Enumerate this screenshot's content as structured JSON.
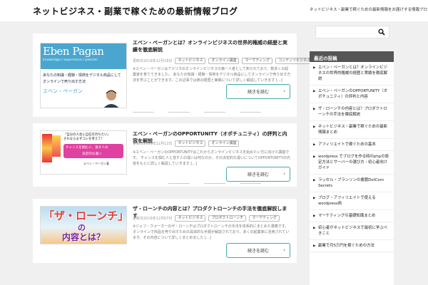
{
  "header": {
    "site_title": "ネットビジネス・副業で稼ぐための最新情報ブログ",
    "site_description": "ネットビジネス・副業で稼ぐための最新情報をお届けする情報ブログです"
  },
  "search": {
    "placeholder": ""
  },
  "posts": [
    {
      "title": "エベン・ペーガンとは？オンラインビジネスの世界的権威の経歴と実績を徹底解説",
      "date": "更新日2019年12月18日",
      "tags": [
        "ネットビジネス",
        "オンライン講座",
        "マーケティング",
        "コンテンツビジネス"
      ],
      "excerpt": "※エベン・ペーガンはアメリカのオンラインビジネスの第一人者として知られており、数多くの起業家を育ててきました。 あなたの知識・経験・情熱をデジタル商品にしてオンラインで売り出す方法を学ぶことができます。この記事では彼の経歴と実績について詳しく解説していきます […]",
      "more_label": "続きを読む",
      "thumb": {
        "name": "Eben Pagan",
        "sub": "knowledge / experience / passion",
        "line1": "あなたの知識・経験・情熱をデジタル商品にして",
        "line2": "オンラインで売り出す方法",
        "kana": "エベン・ペーガン"
      }
    },
    {
      "title": "エベン・ペーガンのOPPORTUNITY（オポチュニティ）の評判と内容を解説",
      "date": "更新日2019年12月12日",
      "tags": [
        "ネットビジネス",
        "オンライン講座"
      ],
      "excerpt": "※エベン・ペーガンのOPPORTUNITYはこれからオンラインビジネスを始めたい方に向けた講座です。 チャンスを掴む人と逃す人の違いは何なのか、その決定的な違いについてOPPORTUNITYの内容をもとに詳しく解説していきます […]",
      "more_label": "続きを読む",
      "thumb": {
        "q1": "「自分の人生に自信を持ちたい」",
        "q2": "それならまずコレを考えて！",
        "p1": "チャンスを掴む人、逃す人の",
        "p2": "決定的な違い",
        "author": "エベン・ペーガン著"
      }
    },
    {
      "title": "ザ・ローンチの内容とは？プロダクトローンチの手法を徹底解説します",
      "date": "更新日2019年12月07日",
      "tags": [
        "ネットビジネス",
        "プロダクトローンチ",
        "マーケティング"
      ],
      "excerpt": "※ジェフ・ウォーカーのザ・ローンチはプロダクトローンチの手法を体系的にまとめた書籍です。 オンラインで商品を売り出すための具体的な手順が解説されており、多くの起業家に活用されています。その内容について詳しくまとめました […]",
      "more_label": "続きを読む",
      "thumb": {
        "big": "「ザ・ローンチ」",
        "no": "の",
        "nai": "内容とは？"
      }
    }
  ],
  "sidebar": {
    "widget_title": "最近の投稿",
    "items": [
      "エベン・ペーガンとは？オンラインビジネスの世界的権威の経歴と実績を徹底解説",
      "エベン・ペーガンのOPPORTUNITY（オポチュニティ）の評判と内容",
      "ザ・ローンチの内容とは？プロダクトローンチの手法を徹底解説",
      "ネットビジネス・副業で稼ぐための最新情報まとめ",
      "アフィリエイトで稼ぐための基本",
      "wordpress でブログを作る時のphpの設定方法とサーバーの選び方・初心者向けガイド",
      "ラッセル・ブランソンの書籍DotCom Secrets",
      "ブログ・アフィリエイトで使える wordpress術",
      "マーケティングの基礎知識まとめ",
      "初心者がネットビジネスで最初に学ぶべきこと",
      "副業で月5万円を稼ぐための方法"
    ]
  }
}
